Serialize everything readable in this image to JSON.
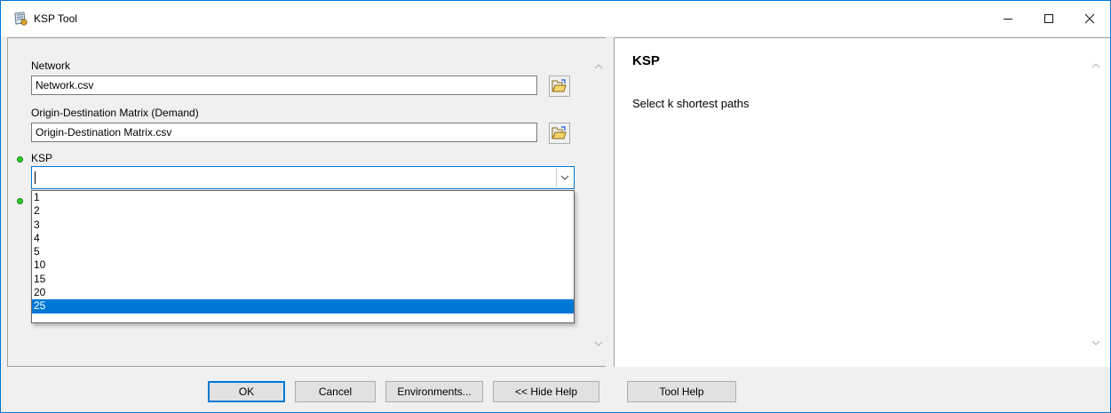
{
  "window": {
    "title": "KSP Tool",
    "minimize_glyph": "—",
    "maximize_glyph": "☐",
    "close_glyph": "✕"
  },
  "form": {
    "network": {
      "label": "Network",
      "value": "Network.csv"
    },
    "od_matrix": {
      "label": "Origin-Destination Matrix (Demand)",
      "value": "Origin-Destination Matrix.csv"
    },
    "ksp": {
      "label": "KSP",
      "value": "",
      "options": [
        "1",
        "2",
        "3",
        "4",
        "5",
        "10",
        "15",
        "20",
        "25"
      ],
      "highlighted": "25"
    }
  },
  "help": {
    "title": "KSP",
    "text": "Select k shortest paths"
  },
  "buttons": {
    "ok": "OK",
    "cancel": "Cancel",
    "environments": "Environments...",
    "hide_help": "<< Hide Help",
    "tool_help": "Tool Help"
  },
  "colors": {
    "accent": "#0078d7",
    "required_dot": "#2fcc2f"
  }
}
